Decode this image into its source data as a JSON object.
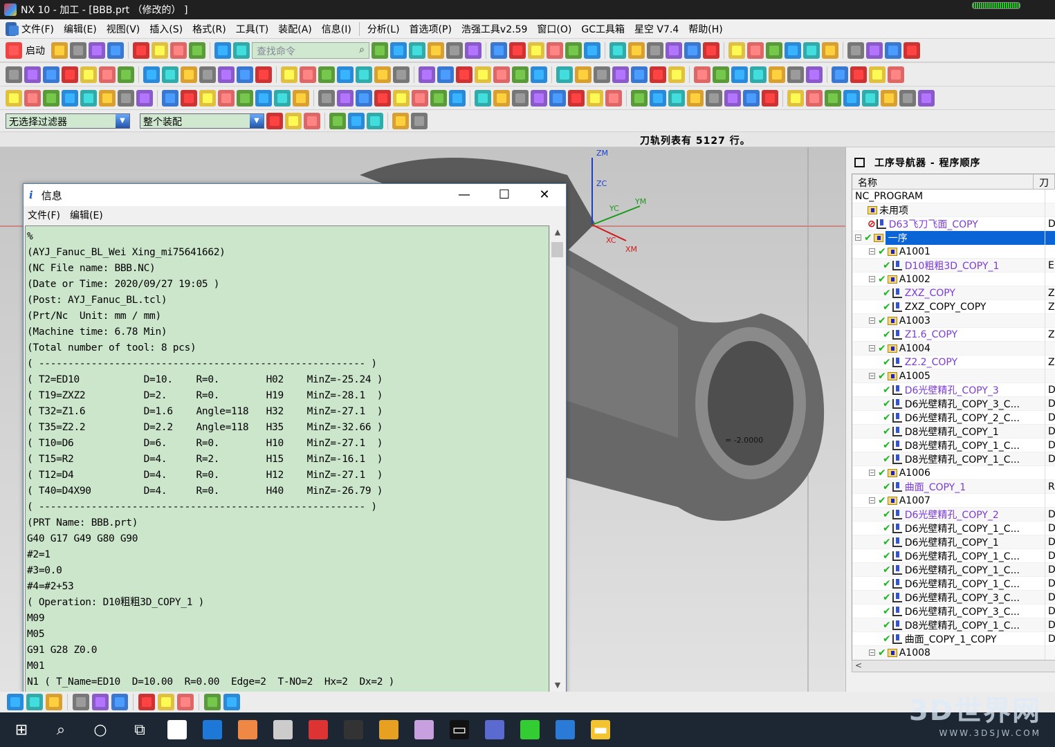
{
  "window": {
    "title": "NX 10 - 加工 - [BBB.prt （修改的） ]"
  },
  "menu": [
    "文件(F)",
    "编辑(E)",
    "视图(V)",
    "插入(S)",
    "格式(R)",
    "工具(T)",
    "装配(A)",
    "信息(I)",
    "分析(L)",
    "首选项(P)",
    "浩强工具v2.59",
    "窗口(O)",
    "GC工具箱",
    "星空 V7.4",
    "帮助(H)"
  ],
  "toolbar": {
    "start_label": "启动",
    "search_placeholder": "查找命令"
  },
  "filters": {
    "selection_filter": "无选择过滤器",
    "assembly_scope": "整个装配"
  },
  "status": {
    "message": "刀轨列表有 5127 行。"
  },
  "viewport": {
    "axes": [
      "ZM",
      "ZC",
      "YC",
      "YM",
      "XC",
      "XM"
    ],
    "annotation": "= -2.0000"
  },
  "info_window": {
    "title": "信息",
    "menu": [
      "文件(F)",
      "编辑(E)"
    ],
    "lines": [
      "%",
      "(AYJ_Fanuc_BL_Wei Xing_mi75641662)",
      "(NC File name: BBB.NC)",
      "(Date or Time: 2020/09/27 19:05 )",
      "(Post: AYJ_Fanuc_BL.tcl)",
      "(Prt/Nc  Unit: mm / mm)",
      "(Machine time: 6.78 Min)",
      "(Total number of tool: 8 pcs)",
      "( -------------------------------------------------------- )",
      "( T2=ED10           D=10.    R=0.        H02    MinZ=-25.24 )",
      "( T19=ZXZ2          D=2.     R=0.        H19    MinZ=-28.1  )",
      "( T32=Z1.6          D=1.6    Angle=118   H32    MinZ=-27.1  )",
      "( T35=Z2.2          D=2.2    Angle=118   H35    MinZ=-32.66 )",
      "( T10=D6            D=6.     R=0.        H10    MinZ=-27.1  )",
      "( T15=R2            D=4.     R=2.        H15    MinZ=-16.1  )",
      "( T12=D4            D=4.     R=0.        H12    MinZ=-27.1  )",
      "( T40=D4X90         D=4.     R=0.        H40    MinZ=-26.79 )",
      "( -------------------------------------------------------- )",
      "(PRT Name: BBB.prt)",
      "G40 G17 G49 G80 G90",
      "#2=1",
      "#3=0.0",
      "#4=#2+53",
      "( Operation: D10粗粗3D_COPY_1 )",
      "M09",
      "M05",
      "G91 G28 Z0.0",
      "M01",
      "N1 ( T_Name=ED10  D=10.00  R=0.00  Edge=2  T-NO=2  Hx=2  Dx=2 )"
    ]
  },
  "navigator": {
    "title": "工序导航器 - 程序顺序",
    "columns": [
      "名称",
      "刀"
    ],
    "rows": [
      {
        "label": "NC_PROGRAM",
        "level": 0,
        "type": "root",
        "color": "#000000",
        "col2": ""
      },
      {
        "label": "未用项",
        "level": 1,
        "type": "folder",
        "color": "#000000",
        "col2": ""
      },
      {
        "label": "D63飞刀飞面_COPY",
        "level": 1,
        "type": "op-disabled",
        "color": "#7a3bd6",
        "col2": "D"
      },
      {
        "label": "一序",
        "level": 0,
        "type": "group",
        "color": "#ffffff",
        "col2": "",
        "selected": true
      },
      {
        "label": "A1001",
        "level": 1,
        "type": "group",
        "color": "#000000",
        "col2": ""
      },
      {
        "label": "D10粗粗3D_COPY_1",
        "level": 2,
        "type": "op",
        "color": "#7a3bd6",
        "col2": "ED"
      },
      {
        "label": "A1002",
        "level": 1,
        "type": "group",
        "color": "#000000",
        "col2": ""
      },
      {
        "label": "ZXZ_COPY",
        "level": 2,
        "type": "op",
        "color": "#7a3bd6",
        "col2": "Z"
      },
      {
        "label": "ZXZ_COPY_COPY",
        "level": 2,
        "type": "op",
        "color": "#000000",
        "col2": "Z"
      },
      {
        "label": "A1003",
        "level": 1,
        "type": "group",
        "color": "#000000",
        "col2": ""
      },
      {
        "label": "Z1.6_COPY",
        "level": 2,
        "type": "op",
        "color": "#7a3bd6",
        "col2": "Z"
      },
      {
        "label": "A1004",
        "level": 1,
        "type": "group",
        "color": "#000000",
        "col2": ""
      },
      {
        "label": "Z2.2_COPY",
        "level": 2,
        "type": "op",
        "color": "#7a3bd6",
        "col2": "Z"
      },
      {
        "label": "A1005",
        "level": 1,
        "type": "group",
        "color": "#000000",
        "col2": ""
      },
      {
        "label": "D6光壁精孔_COPY_3",
        "level": 2,
        "type": "op",
        "color": "#7a3bd6",
        "col2": "D"
      },
      {
        "label": "D6光壁精孔_COPY_3_C...",
        "level": 2,
        "type": "op",
        "color": "#000000",
        "col2": "D"
      },
      {
        "label": "D6光壁精孔_COPY_2_C...",
        "level": 2,
        "type": "op",
        "color": "#000000",
        "col2": "D"
      },
      {
        "label": "D8光壁精孔_COPY_1",
        "level": 2,
        "type": "op",
        "color": "#000000",
        "col2": "D"
      },
      {
        "label": "D8光壁精孔_COPY_1_C...",
        "level": 2,
        "type": "op",
        "color": "#000000",
        "col2": "D"
      },
      {
        "label": "D8光壁精孔_COPY_1_C...",
        "level": 2,
        "type": "op",
        "color": "#000000",
        "col2": "D"
      },
      {
        "label": "A1006",
        "level": 1,
        "type": "group",
        "color": "#000000",
        "col2": ""
      },
      {
        "label": "曲面_COPY_1",
        "level": 2,
        "type": "op",
        "color": "#7a3bd6",
        "col2": "R"
      },
      {
        "label": "A1007",
        "level": 1,
        "type": "group",
        "color": "#000000",
        "col2": ""
      },
      {
        "label": "D6光壁精孔_COPY_2",
        "level": 2,
        "type": "op",
        "color": "#7a3bd6",
        "col2": "D"
      },
      {
        "label": "D6光壁精孔_COPY_1_C...",
        "level": 2,
        "type": "op",
        "color": "#000000",
        "col2": "D"
      },
      {
        "label": "D6光壁精孔_COPY_1",
        "level": 2,
        "type": "op",
        "color": "#000000",
        "col2": "D"
      },
      {
        "label": "D6光壁精孔_COPY_1_C...",
        "level": 2,
        "type": "op",
        "color": "#000000",
        "col2": "D"
      },
      {
        "label": "D6光壁精孔_COPY_1_C...",
        "level": 2,
        "type": "op",
        "color": "#000000",
        "col2": "D"
      },
      {
        "label": "D6光壁精孔_COPY_1_C...",
        "level": 2,
        "type": "op",
        "color": "#000000",
        "col2": "D"
      },
      {
        "label": "D6光壁精孔_COPY_3_C...",
        "level": 2,
        "type": "op",
        "color": "#000000",
        "col2": "D"
      },
      {
        "label": "D6光壁精孔_COPY_3_C...",
        "level": 2,
        "type": "op",
        "color": "#000000",
        "col2": "D"
      },
      {
        "label": "D8光壁精孔_COPY_1_C...",
        "level": 2,
        "type": "op",
        "color": "#000000",
        "col2": "D"
      },
      {
        "label": "曲面_COPY_1_COPY",
        "level": 2,
        "type": "op",
        "color": "#000000",
        "col2": "D"
      },
      {
        "label": "A1008",
        "level": 1,
        "type": "group",
        "color": "#000000",
        "col2": ""
      }
    ]
  },
  "taskbar": {
    "icons": [
      "windows-start",
      "search",
      "cortana",
      "task-view",
      "pinwheel-app",
      "ie-browser",
      "chrome-browser",
      "calculator",
      "paint-app",
      "calculator-2",
      "nx-app",
      "3d-box-app",
      "terminal",
      "image-viewer",
      "wechat",
      "nx-app-2",
      "file-explorer"
    ]
  },
  "watermark": {
    "brand": "3D世界网",
    "url": "WWW.3DSJW.COM"
  },
  "colors": {
    "code_bg": "#cce6cc",
    "selection": "#0a64d6",
    "op_purple": "#7a3bd6",
    "check_green": "#1bb81b"
  }
}
